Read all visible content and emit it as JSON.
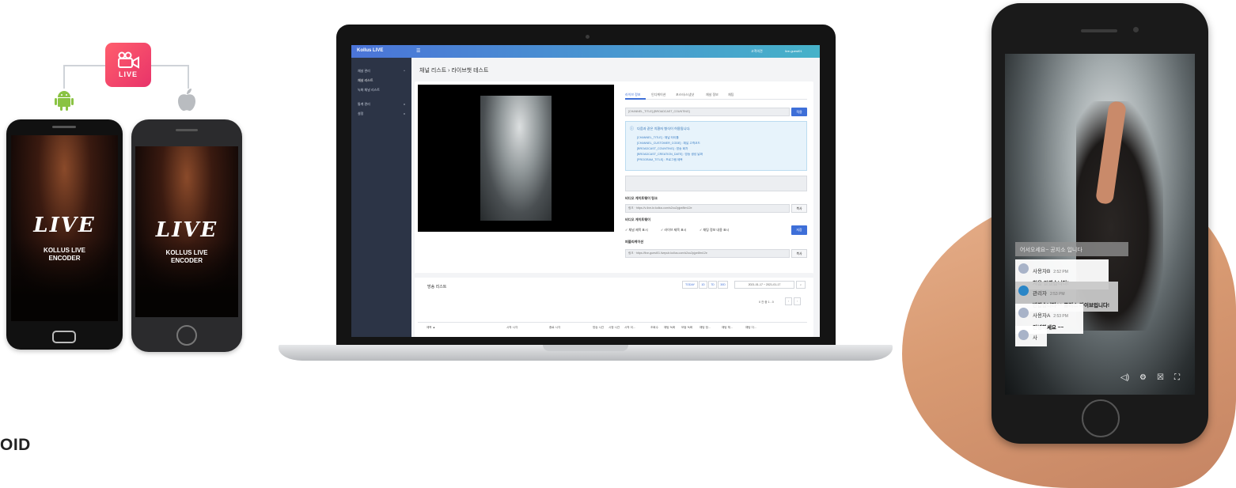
{
  "encoder": {
    "badge_label": "LIVE",
    "phone_live_text": "LIVE",
    "phone_encoder_line1": "KOLLUS LIVE",
    "phone_encoder_line2": "ENCODER",
    "side_label": "OID",
    "android_screen_bg": "#3a1a10",
    "badge_color": "#e8336a"
  },
  "admin": {
    "logo": "Kollus LIVE",
    "top_links": [
      "고객의견",
      "live-guest01"
    ],
    "sidebar": [
      {
        "label": "채널 관리",
        "active": false,
        "expanded": true
      },
      {
        "label": "채널 리스트",
        "active": true
      },
      {
        "label": "녹화 채널 리스트",
        "active": false
      },
      {
        "label": "통계 관리",
        "active": false,
        "expanded": false
      },
      {
        "label": "설정",
        "active": false,
        "expanded": false
      }
    ],
    "breadcrumb": "채널 리스트 › 라이브챗 테스트",
    "tabs": [
      "라이브 정보",
      "인디케이션",
      "포스터/스냅샷",
      "채널 정보",
      "채팅"
    ],
    "title_input": "[CHANNEL_TITLE]-[BROADCAST_COUNTING]",
    "apply_button": "적용",
    "info_title": "다음과 같은 치환자 형식이 허용됩니다.",
    "info_lines": [
      "[CHANNEL_TITLE] : 채널 타이틀",
      "[CHANNEL_CUSTOMER_CODE] : 채널 고객코드",
      "[BROADCAST_COUNTING] : 방송 회차",
      "[BROADCAST_CREATION_DATE] : 방송 생성 날짜",
      "[PROGRAM_TITLE] : 프로그램 제목"
    ],
    "video_gateway_label": "비디오 게이트웨이 링크",
    "video_gateway_url": "링크 · https://v-live-kr.kollus.com/s2ou2pjpe8tm12e",
    "copy_button": "복사",
    "video_gateway_options_label": "비디오 게이트웨이",
    "checks": [
      "채널 제목 표시",
      "라이브 제목 표시",
      "채팅 정보 내용 표시"
    ],
    "save_button": "저장",
    "embed_label": "퍼블리케이션",
    "embed_url": "링크 · https://live-guest01.livepub.kollus.com/s2ou2pjpe8tm12e",
    "list_title": "방송 리스트",
    "filters": [
      "TODAY",
      "1D",
      "7D",
      "30D"
    ],
    "date_range": "2021-01-17 ~ 2021-01-17",
    "pagination": "0 건 중 1 - 0",
    "table_headers": [
      "제목 ▲",
      "시작 시각",
      "종료 시각",
      "방송 시간",
      "시청 시간",
      "시작 이...",
      "조회수",
      "채팅 녹화",
      "모둠 녹화",
      "채팅 정...",
      "채팅 체...",
      "채팅 다..."
    ],
    "accent_color": "#3e6fd8"
  },
  "viewer": {
    "notice": "어서오세요~ 공지소 입니다",
    "chats": [
      {
        "user": "사용자B",
        "time": "2:52 PM",
        "message": "처음 왔겠습니다!",
        "admin": false
      },
      {
        "user": "관리자",
        "time": "2:53 PM",
        "message": "반갑습니다^^ 콜러스 라이브입니다!",
        "admin": true
      },
      {
        "user": "사용자A",
        "time": "2:53 PM",
        "message": "안녕하세요 ~~",
        "admin": false
      },
      {
        "user": "사",
        "time": "",
        "message": "",
        "admin": false
      }
    ]
  }
}
